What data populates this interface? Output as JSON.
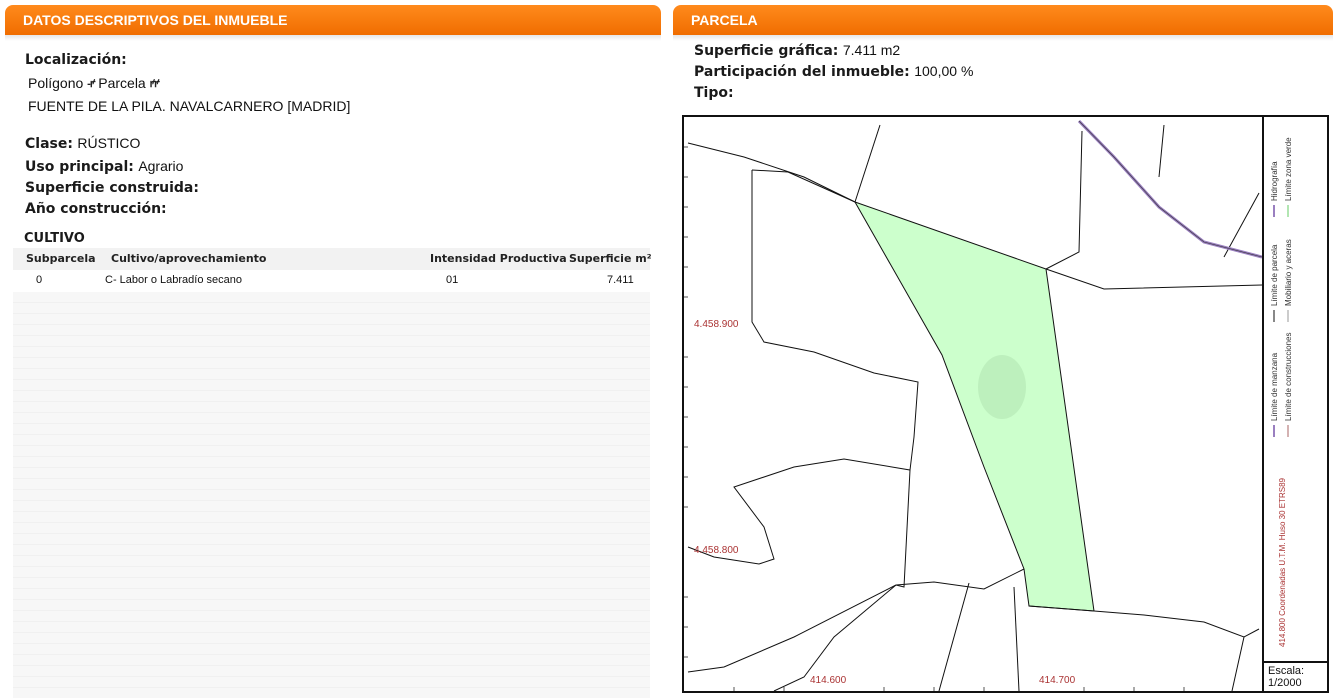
{
  "left_panel": {
    "title": "DATOS DESCRIPTIVOS DEL INMUEBLE",
    "localizacion_label": "Localización:",
    "poligono_label": "Polígono",
    "parcela_label": "Parcela",
    "address": "FUENTE DE LA PILA. NAVALCARNERO [MADRID]",
    "clase_label": "Clase:",
    "clase_value": "RÚSTICO",
    "uso_label": "Uso principal:",
    "uso_value": "Agrario",
    "superficie_construida_label": "Superficie construida:",
    "anio_label": "Año construcción:",
    "cultivo": {
      "title": "CULTIVO",
      "headers": [
        "Subparcela",
        "Cultivo/aprovechamiento",
        "Intensidad Productiva",
        "Superficie m²"
      ],
      "rows": [
        [
          "0",
          "C- Labor o Labradío secano",
          "01",
          "7.411"
        ]
      ]
    }
  },
  "right_panel": {
    "title": "PARCELA",
    "superficie_grafica_label": "Superficie gráfica:",
    "superficie_grafica_value": "7.411 m2",
    "participacion_label": "Participación del inmueble:",
    "participacion_value": "100,00 %",
    "tipo_label": "Tipo:",
    "map": {
      "coord_labels": {
        "y1": "4.458.900",
        "y2": "4.458.800",
        "x1": "414.600",
        "x2": "414.700"
      },
      "legend": {
        "hidrografia": "Hidrografía",
        "limite_zona_verde": "Límite zona verde",
        "limite_parcela": "Límite de parcela",
        "mobiliario": "Mobiliario y aceras",
        "limite_manzana": "Límite de manzana",
        "limite_construcciones": "Límite de construcciones",
        "coordenadas": "414.800 Coordenadas U.T.M. Huso 30 ETRS89",
        "escala_label": "Escala:",
        "escala_value": "1/2000"
      },
      "colors": {
        "parcel_fill": "#ccffcc",
        "hydro": "#9a7fc0",
        "coords": "#aa3333"
      }
    }
  }
}
